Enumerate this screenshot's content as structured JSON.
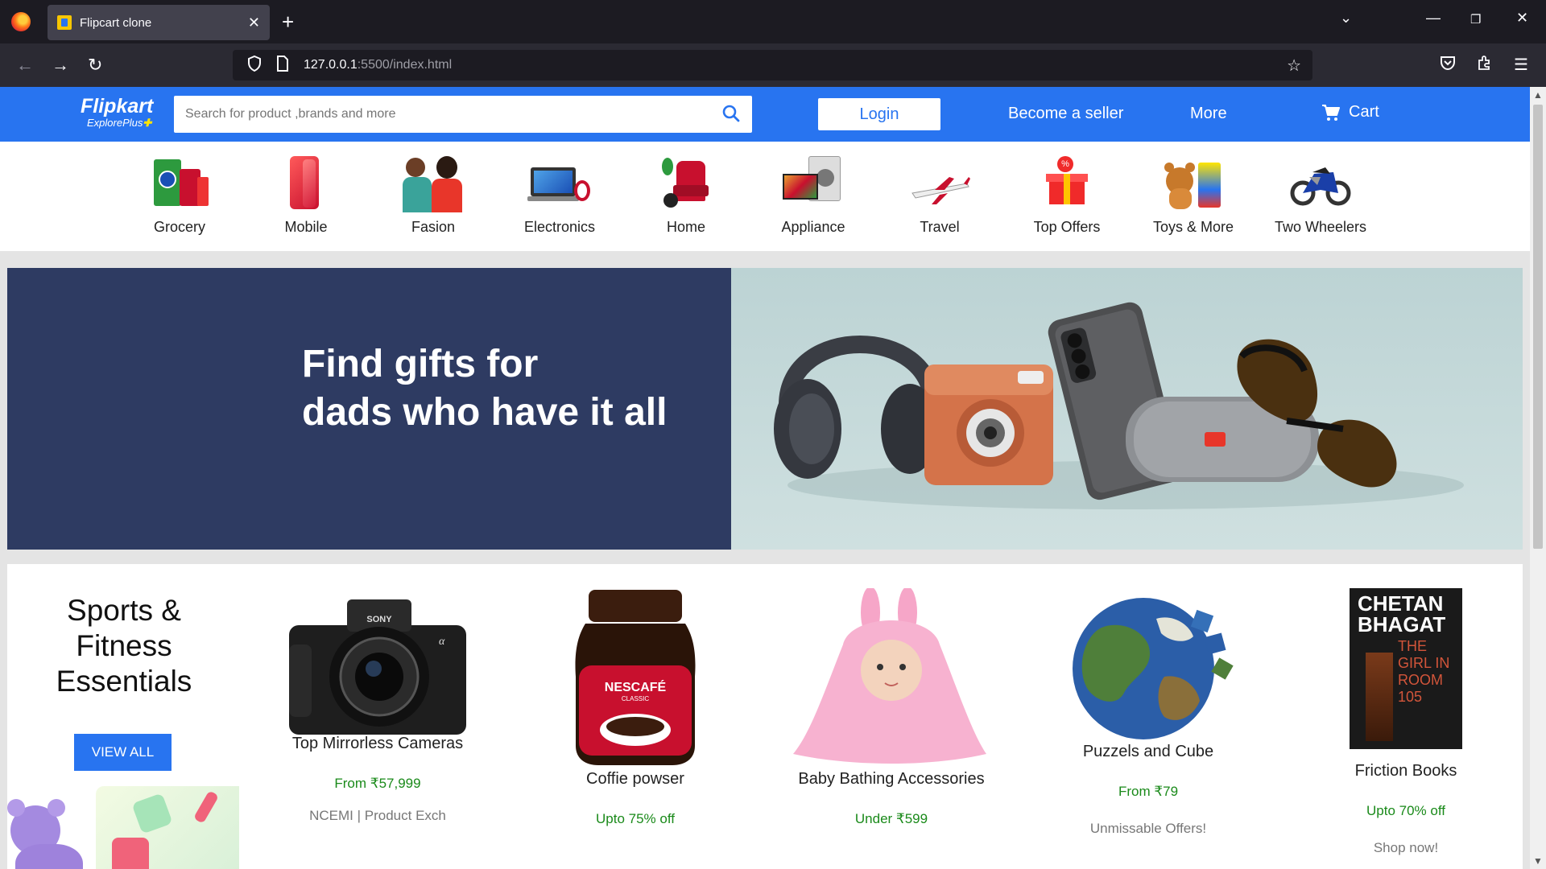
{
  "browser": {
    "tab_title": "Flipcart clone",
    "url_host": "127.0.0.1",
    "url_rest": ":5500/index.html"
  },
  "header": {
    "logo": "Flipkart",
    "logo_sub": "ExplorePlus",
    "search_placeholder": "Search for product ,brands and more",
    "login": "Login",
    "become_seller": "Become a seller",
    "more": "More",
    "cart": "Cart"
  },
  "categories": [
    {
      "label": "Grocery"
    },
    {
      "label": "Mobile"
    },
    {
      "label": "Fasion"
    },
    {
      "label": "Electronics"
    },
    {
      "label": "Home"
    },
    {
      "label": "Appliance"
    },
    {
      "label": "Travel"
    },
    {
      "label": "Top Offers"
    },
    {
      "label": "Toys & More"
    },
    {
      "label": "Two Wheelers"
    }
  ],
  "banner": {
    "line1": "Find gifts for",
    "line2": "dads who have it all"
  },
  "featured": {
    "title": "Sports & Fitness Essentials",
    "view_all": "VIEW ALL"
  },
  "products": [
    {
      "name": "Top Mirrorless Cameras",
      "offer": "From ₹57,999",
      "sub": "NCEMI | Product Exch"
    },
    {
      "name": "Coffie powser",
      "offer": "Upto 75% off",
      "sub": ""
    },
    {
      "name": "Baby Bathing Accessories",
      "offer": "Under ₹599",
      "sub": ""
    },
    {
      "name": "Puzzels and Cube",
      "offer": "From ₹79",
      "sub": "Unmissable Offers!"
    },
    {
      "name": "Friction Books",
      "offer": "Upto 70% off",
      "sub": "Shop now!"
    }
  ],
  "book_cover": {
    "author": "CHETAN BHAGAT",
    "title": "THE GIRL IN ROOM 105"
  },
  "icons": [
    "firefox-icon",
    "back-icon",
    "forward-icon",
    "reload-icon",
    "shield-icon",
    "page-icon",
    "star-icon",
    "pocket-icon",
    "extensions-icon",
    "menu-icon",
    "search-icon",
    "cart-icon"
  ],
  "colors": {
    "brand": "#2874f0",
    "banner_left": "#2e3b62",
    "offer_green": "#1a8a1a"
  }
}
